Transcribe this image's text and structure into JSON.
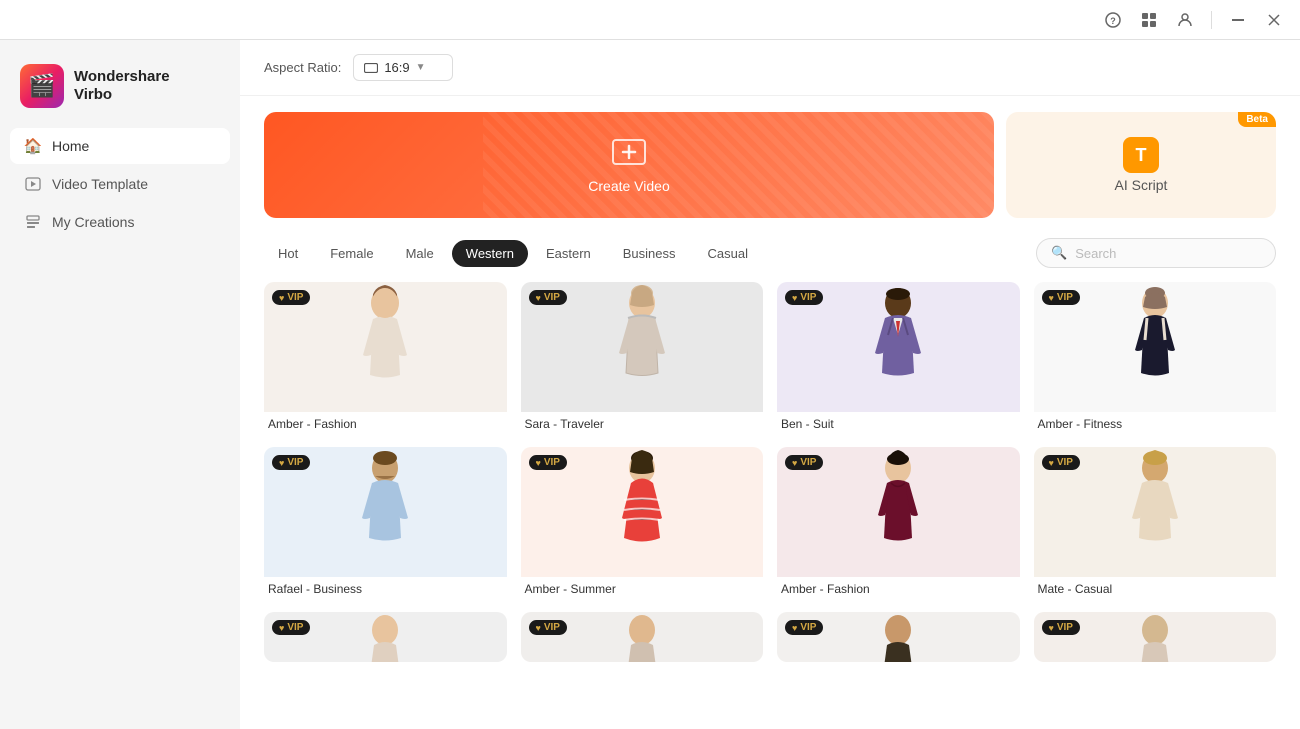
{
  "app": {
    "name": "Wondershare",
    "name2": "Virbo"
  },
  "titlebar": {
    "icons": [
      "help",
      "grid",
      "user",
      "minimize",
      "close"
    ]
  },
  "sidebar": {
    "items": [
      {
        "id": "home",
        "label": "Home",
        "icon": "🏠",
        "active": true
      },
      {
        "id": "video-template",
        "label": "Video Template",
        "icon": "🎬",
        "active": false
      },
      {
        "id": "my-creations",
        "label": "My Creations",
        "icon": "📋",
        "active": false
      }
    ]
  },
  "toolbar": {
    "aspect_ratio_label": "Aspect Ratio:",
    "aspect_ratio_value": "16:9"
  },
  "banners": {
    "create": {
      "label": "Create Video"
    },
    "ai": {
      "label": "AI Script",
      "beta": "Beta"
    }
  },
  "tabs": {
    "items": [
      {
        "id": "hot",
        "label": "Hot",
        "active": false
      },
      {
        "id": "female",
        "label": "Female",
        "active": false
      },
      {
        "id": "male",
        "label": "Male",
        "active": false
      },
      {
        "id": "western",
        "label": "Western",
        "active": true
      },
      {
        "id": "eastern",
        "label": "Eastern",
        "active": false
      },
      {
        "id": "business",
        "label": "Business",
        "active": false
      },
      {
        "id": "casual",
        "label": "Casual",
        "active": false
      }
    ],
    "search_placeholder": "Search"
  },
  "avatars": [
    {
      "id": 1,
      "name": "Amber - Fashion",
      "bg": "bg-light",
      "vip": true,
      "figure_color": "#c8a98a",
      "outfit": "light"
    },
    {
      "id": 2,
      "name": "Sara - Traveler",
      "bg": "bg-gray",
      "vip": true,
      "figure_color": "#d4b896",
      "outfit": "striped"
    },
    {
      "id": 3,
      "name": "Ben - Suit",
      "bg": "bg-purple",
      "vip": true,
      "figure_color": "#4a3728",
      "outfit": "suit"
    },
    {
      "id": 4,
      "name": "Amber - Fitness",
      "bg": "bg-white",
      "vip": true,
      "figure_color": "#c8a98a",
      "outfit": "fitness"
    },
    {
      "id": 5,
      "name": "Rafael - Business",
      "bg": "bg-blue",
      "vip": true,
      "figure_color": "#c0a080",
      "outfit": "shirt"
    },
    {
      "id": 6,
      "name": "Amber - Summer",
      "bg": "bg-peach",
      "vip": true,
      "figure_color": "#d4a882",
      "outfit": "summer"
    },
    {
      "id": 7,
      "name": "Amber - Fashion",
      "bg": "bg-wine",
      "vip": true,
      "figure_color": "#c8a98a",
      "outfit": "wine"
    },
    {
      "id": 8,
      "name": "Mate - Casual",
      "bg": "bg-beige",
      "vip": true,
      "figure_color": "#b8956e",
      "outfit": "casual"
    },
    {
      "id": 9,
      "name": "",
      "bg": "bg-gray2",
      "vip": true,
      "figure_color": "#c8a080",
      "outfit": "bottom1"
    },
    {
      "id": 10,
      "name": "",
      "bg": "bg-light2",
      "vip": true,
      "figure_color": "#c0a080",
      "outfit": "bottom2"
    },
    {
      "id": 11,
      "name": "",
      "bg": "bg-light3",
      "vip": true,
      "figure_color": "#b89060",
      "outfit": "bottom3"
    },
    {
      "id": 12,
      "name": "",
      "bg": "bg-warm",
      "vip": true,
      "figure_color": "#d4b890",
      "outfit": "bottom4"
    }
  ]
}
